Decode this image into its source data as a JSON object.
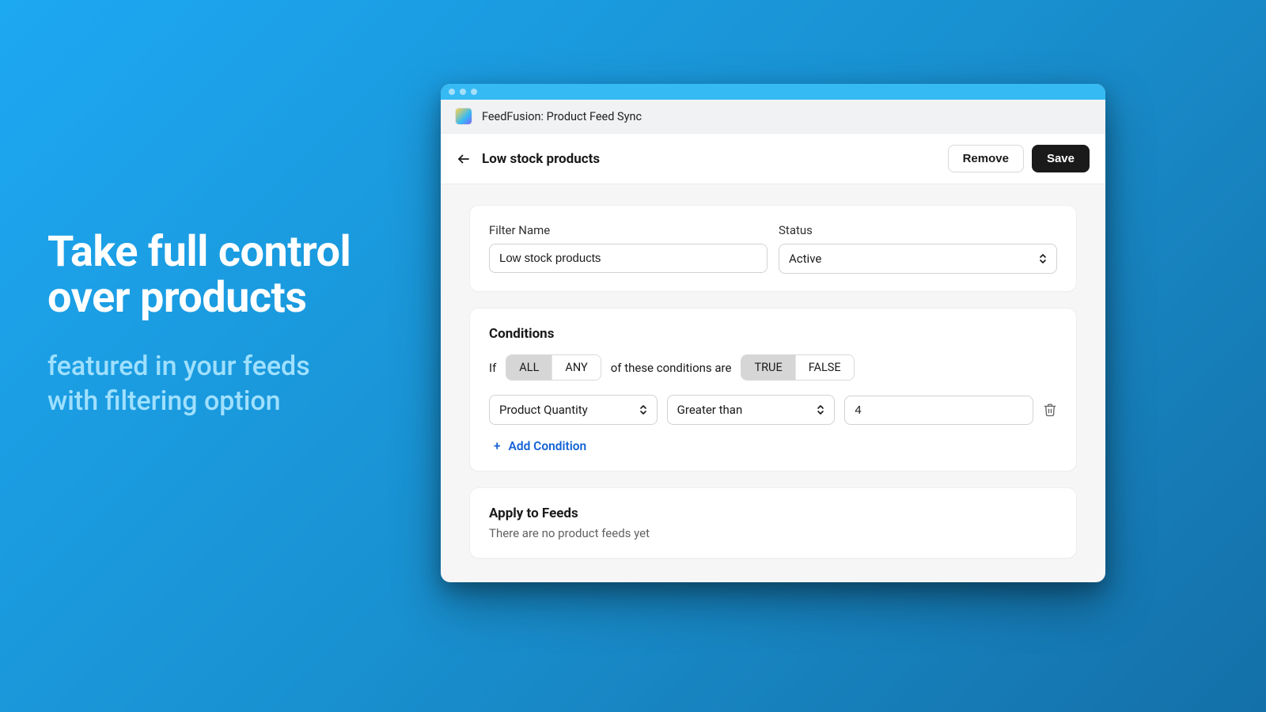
{
  "marketing": {
    "headline_line1": "Take full control",
    "headline_line2": "over products",
    "sub_line1": "featured in your feeds",
    "sub_line2": "with filtering option"
  },
  "app": {
    "title": "FeedFusion: Product Feed Sync"
  },
  "page": {
    "title": "Low stock products",
    "remove_label": "Remove",
    "save_label": "Save"
  },
  "filter_card": {
    "name_label": "Filter Name",
    "name_value": "Low stock products",
    "status_label": "Status",
    "status_value": "Active"
  },
  "conditions": {
    "title": "Conditions",
    "if_text": "If",
    "all_label": "ALL",
    "any_label": "ANY",
    "mid_text": "of these conditions are",
    "true_label": "TRUE",
    "false_label": "FALSE",
    "field_value": "Product Quantity",
    "op_value": "Greater than",
    "value": "4",
    "add_label": "Add Condition"
  },
  "feeds_card": {
    "title": "Apply to Feeds",
    "empty": "There are no product feeds yet"
  }
}
